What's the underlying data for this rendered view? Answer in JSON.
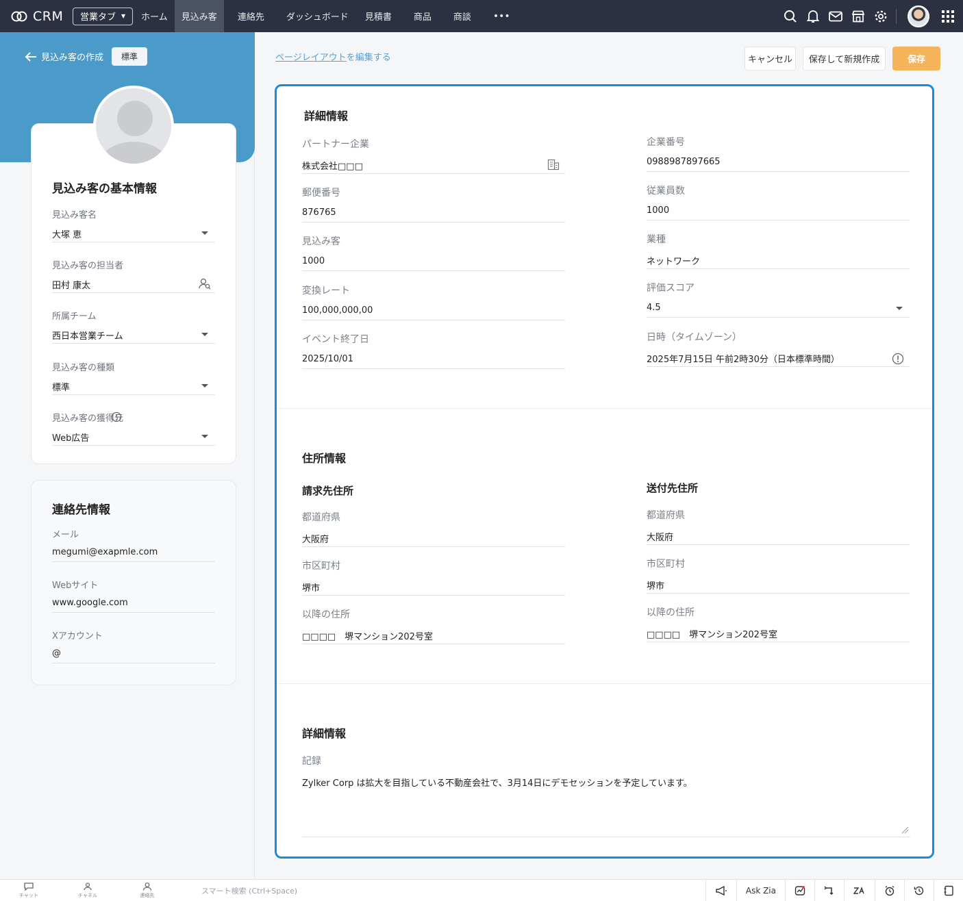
{
  "app": {
    "name": "CRM"
  },
  "topnav": {
    "tab_selector": "営業タブ",
    "items": [
      "ホーム",
      "見込み客",
      "連絡先",
      "ダッシュボード",
      "見積書",
      "商品",
      "商談"
    ],
    "more": "•••",
    "icons": [
      "search-icon",
      "bell-icon",
      "mail-icon",
      "store-icon",
      "gear-icon",
      "avatar",
      "apps-grid-icon"
    ]
  },
  "left": {
    "back_label": "見込み客の作成",
    "layout_badge": "標準",
    "basic": {
      "title": "見込み客の基本情報",
      "fields": [
        {
          "label": "見込み客名",
          "value": "大塚 恵"
        },
        {
          "label": "見込み客の担当者",
          "value": "田村 康太"
        },
        {
          "label": "所属チーム",
          "value": "西日本営業チーム"
        },
        {
          "label": "見込み客の種類",
          "value": "標準"
        },
        {
          "label": "見込み客の獲得元",
          "value": "Web広告"
        }
      ]
    },
    "contact": {
      "title": "連絡先情報",
      "fields": [
        {
          "label": "メール",
          "value": "megumi@exapmle.com"
        },
        {
          "label": "Webサイト",
          "value": "www.google.com"
        },
        {
          "label": "Xアカウント",
          "value": "@"
        }
      ]
    }
  },
  "header": {
    "edit_layout_link": "ページレイアウト",
    "edit_layout_suffix": "を編集する",
    "cancel": "キャンセル",
    "save_and_new": "保存して新規作成",
    "save": "保存"
  },
  "details": {
    "title": "詳細情報",
    "left_fields": [
      {
        "label": "パートナー企業",
        "value": "株式会社□□□"
      },
      {
        "label": "郵便番号",
        "value": "876765"
      },
      {
        "label": "見込み客",
        "value": "1000"
      },
      {
        "label": "変換レート",
        "value": "100,000,000,00"
      },
      {
        "label": "イベント終了日",
        "value": "2025/10/01"
      }
    ],
    "right_fields": [
      {
        "label": "企業番号",
        "value": "0988987897665"
      },
      {
        "label": "従業員数",
        "value": "1000"
      },
      {
        "label": "業種",
        "value": "ネットワーク"
      },
      {
        "label": "評価スコア",
        "value": "4.5"
      },
      {
        "label": "日時（タイムゾーン）",
        "value": "2025年7月15日 午前2時30分（日本標準時間）"
      }
    ]
  },
  "address": {
    "title": "住所情報",
    "billing": {
      "title": "請求先住所",
      "fields": [
        {
          "label": "都道府県",
          "value": "大阪府"
        },
        {
          "label": "市区町村",
          "value": "堺市"
        },
        {
          "label": "以降の住所",
          "value": "□□□□　堺マンション202号室"
        }
      ]
    },
    "shipping": {
      "title": "送付先住所",
      "fields": [
        {
          "label": "都道府県",
          "value": "大阪府"
        },
        {
          "label": "市区町村",
          "value": "堺市"
        },
        {
          "label": "以降の住所",
          "value": "□□□□　堺マンション202号室"
        }
      ]
    }
  },
  "notes": {
    "title": "詳細情報",
    "label": "記録",
    "value": "Zylker Corp は拡大を目指している不動産会社で、3月14日にデモセッションを予定しています。"
  },
  "bottombar": {
    "chat": "チャット",
    "channel": "チャネル",
    "contacts": "連絡先",
    "search_placeholder": "スマート検索 (Ctrl+Space)",
    "ask_zia": "Ask Zia"
  }
}
